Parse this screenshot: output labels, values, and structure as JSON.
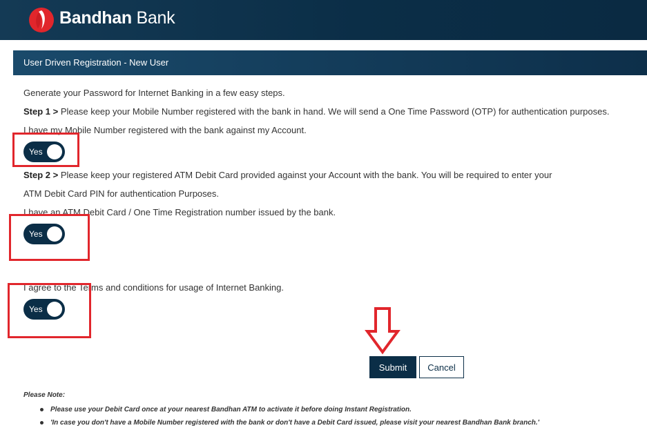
{
  "brand": {
    "name_bold": "Bandhan",
    "name_light": "Bank",
    "logo_icon": "bandhan-logo-icon",
    "colors": {
      "navy": "#0b2e47",
      "red": "#e1262c",
      "white": "#ffffff"
    }
  },
  "section": {
    "title": "User Driven Registration - New User"
  },
  "intro": "Generate your Password for Internet Banking in a few easy steps.",
  "step1": {
    "label": "Step 1 >",
    "text": "Please keep your Mobile Number registered with the bank in hand. We will send a One Time Password (OTP) for authentication purposes.",
    "question": "I have my Mobile Number registered with the bank against my Account.",
    "toggle_label": "Yes"
  },
  "step2": {
    "label": "Step 2 >",
    "text_line1": "Please keep your registered ATM Debit Card provided against your Account with the bank. You will be required to enter your",
    "text_line2": "ATM Debit Card PIN for authentication Purposes.",
    "question": "I have an ATM Debit Card / One Time Registration number issued by the bank.",
    "toggle_label": "Yes"
  },
  "terms": {
    "question": "I agree to the Terms and conditions for usage of Internet Banking.",
    "toggle_label": "Yes"
  },
  "actions": {
    "submit_label": "Submit",
    "cancel_label": "Cancel"
  },
  "notes": {
    "title": "Please Note:",
    "items": [
      "Please use your Debit Card once at your nearest Bandhan ATM to activate it before doing Instant Registration.",
      "'In case you don't have a Mobile Number registered with the bank or don't have a Debit Card issued, please visit your nearest Bandhan Bank branch.'"
    ]
  }
}
